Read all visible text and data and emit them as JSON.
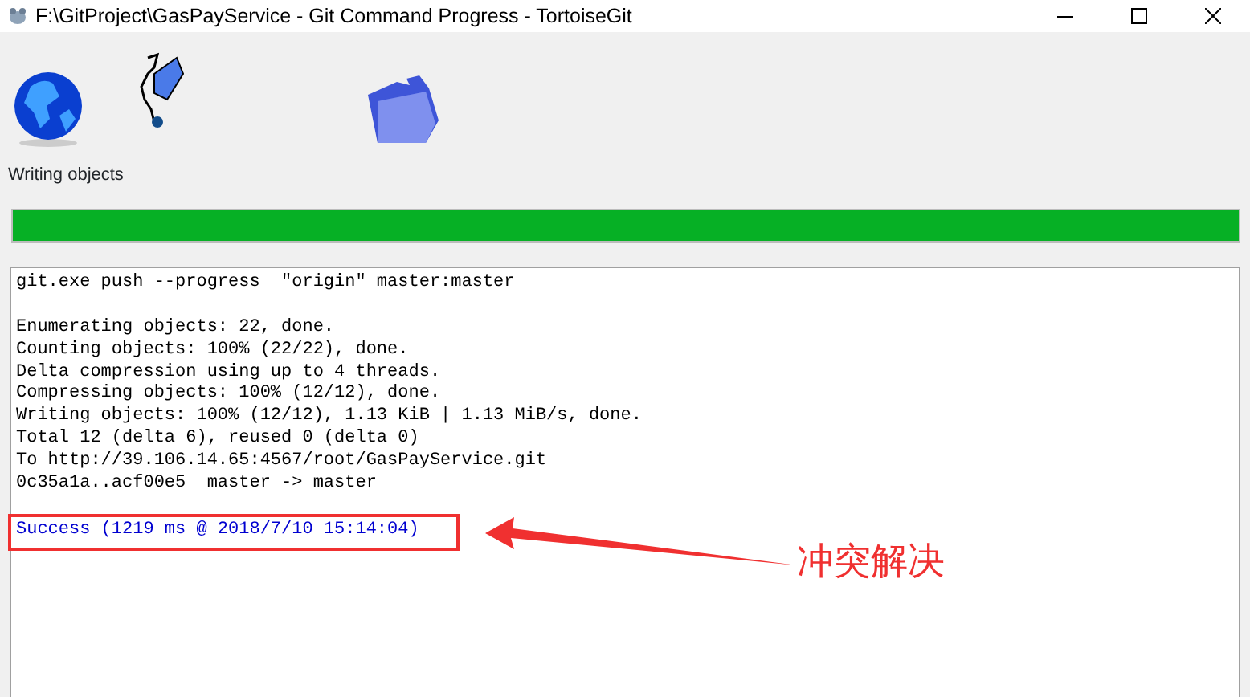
{
  "window": {
    "title": "F:\\GitProject\\GasPayService - Git Command Progress - TortoiseGit"
  },
  "status_label": "Writing objects",
  "progress": {
    "level": 1
  },
  "log": [
    {
      "kind": "command",
      "text": "git.exe push --progress  \"origin\" master:master"
    },
    {
      "kind": "blank"
    },
    {
      "kind": "output",
      "text": "Enumerating objects: 22, done."
    },
    {
      "kind": "output",
      "text": "Counting objects: 100% (22/22), done."
    },
    {
      "kind": "output",
      "text": "Delta compression using up to 4 threads."
    },
    {
      "kind": "output",
      "text": "Compressing objects: 100% (12/12), done."
    },
    {
      "kind": "output",
      "text": "Writing objects: 100% (12/12), 1.13 KiB | 1.13 MiB/s, done."
    },
    {
      "kind": "output",
      "text": "Total 12 (delta 6), reused 0 (delta 0)"
    },
    {
      "kind": "output",
      "text": "To http://39.106.14.65:4567/root/GasPayService.git"
    },
    {
      "kind": "output",
      "text": "0c35a1a..acf00e5  master -> master"
    },
    {
      "kind": "blank"
    },
    {
      "kind": "success",
      "text": "Success (1219 ms @ 2018/7/10 15:14:04)"
    }
  ],
  "annotation": {
    "text": "冲突解决"
  }
}
